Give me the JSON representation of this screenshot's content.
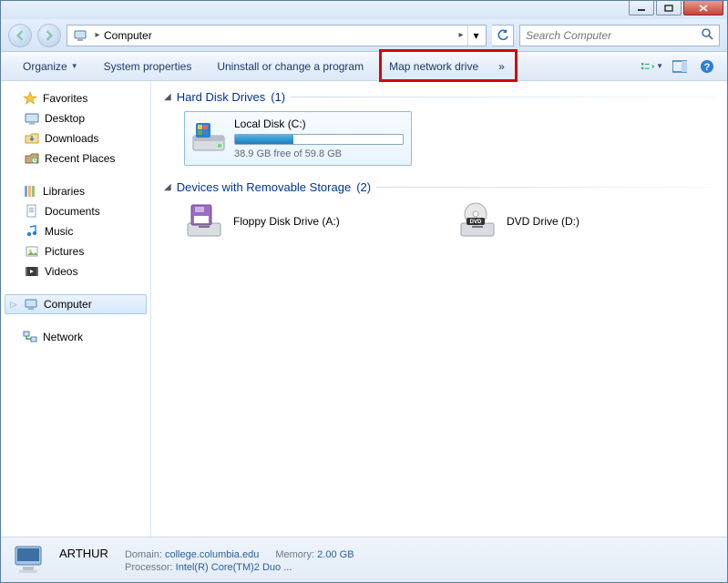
{
  "titlebar": {},
  "address": {
    "path": "Computer",
    "chevron": "▶"
  },
  "search": {
    "placeholder": "Search Computer"
  },
  "toolbar": {
    "organize": "Organize",
    "system_properties": "System properties",
    "uninstall": "Uninstall or change a program",
    "map_network": "Map network drive",
    "overflow_glyph": "»"
  },
  "sidebar": {
    "favorites": {
      "label": "Favorites",
      "items": [
        "Desktop",
        "Downloads",
        "Recent Places"
      ]
    },
    "libraries": {
      "label": "Libraries",
      "items": [
        "Documents",
        "Music",
        "Pictures",
        "Videos"
      ]
    },
    "computer": {
      "label": "Computer"
    },
    "network": {
      "label": "Network"
    }
  },
  "content": {
    "hdd": {
      "heading": "Hard Disk Drives",
      "count": "(1)",
      "drive": {
        "name": "Local Disk (C:)",
        "free_text": "38.9 GB free of 59.8 GB",
        "used_pct": 35
      }
    },
    "removable": {
      "heading": "Devices with Removable Storage",
      "count": "(2)",
      "items": [
        {
          "name": "Floppy Disk Drive (A:)"
        },
        {
          "name": "DVD Drive (D:)"
        }
      ]
    }
  },
  "status": {
    "computer_name": "ARTHUR",
    "domain_label": "Domain:",
    "domain_value": "college.columbia.edu",
    "memory_label": "Memory:",
    "memory_value": "2.00 GB",
    "processor_label": "Processor:",
    "processor_value": "Intel(R) Core(TM)2 Duo ..."
  },
  "highlight": {
    "present": true
  }
}
